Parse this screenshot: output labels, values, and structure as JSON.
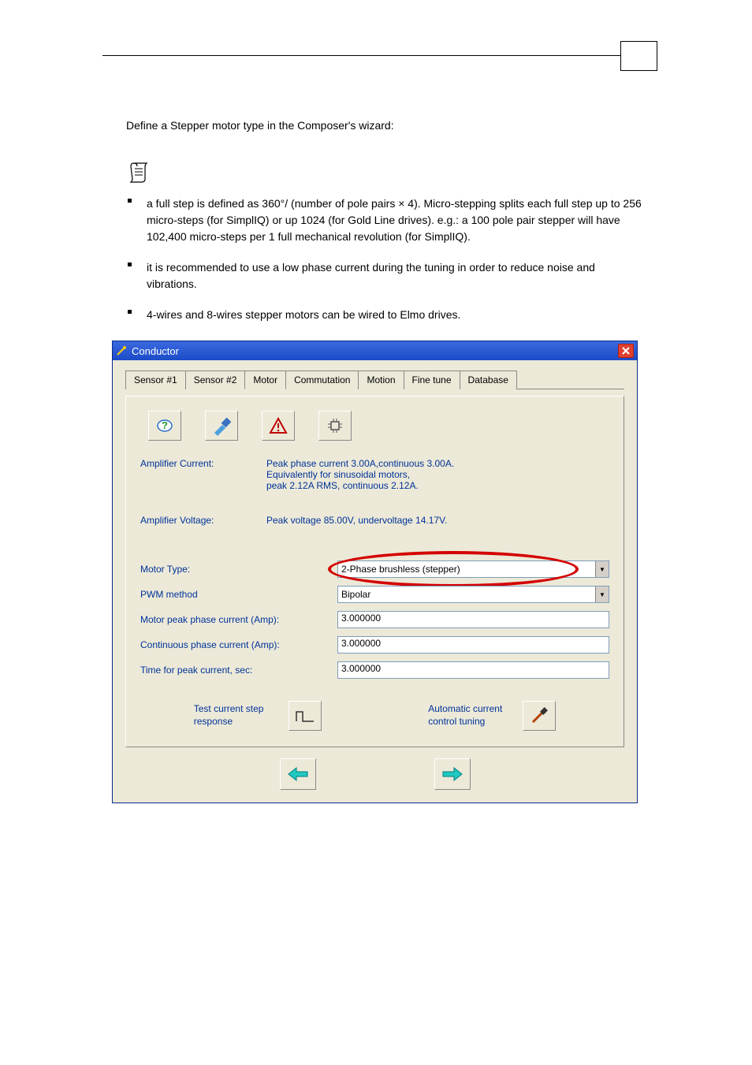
{
  "doc": {
    "intro_line": "Define a Stepper motor type in the Composer's wizard:",
    "notes": [
      "a full step is defined as 360°/ (number of pole pairs × 4). Micro-stepping splits each full step up to 256 micro-steps (for SimplIQ)  or up 1024 (for Gold Line drives). e.g.: a 100 pole pair stepper will have 102,400 micro-steps per 1 full mechanical revolution (for SimplIQ).",
      "it is recommended to use a low phase current during the tuning in order to reduce noise and vibrations.",
      "4-wires and 8-wires stepper motors can be wired to Elmo drives."
    ]
  },
  "dialog": {
    "title": "Conductor",
    "tabs": [
      "Sensor #1",
      "Sensor #2",
      "Motor",
      "Commutation",
      "Motion",
      "Fine tune",
      "Database"
    ],
    "selected_tab_index": 2,
    "amp_current_label": "Amplifier Current:",
    "amp_current_value": "Peak phase current 3.00A,continuous 3.00A.\nEquivalently for sinusoidal motors,\npeak 2.12A RMS, continuous 2.12A.",
    "amp_voltage_label": "Amplifier Voltage:",
    "amp_voltage_value": "Peak voltage 85.00V, undervoltage 14.17V.",
    "fields": {
      "motor_type_label": "Motor Type:",
      "motor_type_value": "2-Phase brushless (stepper)",
      "pwm_label": "PWM method",
      "pwm_value": "Bipolar",
      "peak_current_label": "Motor peak phase current (Amp):",
      "peak_current_value": "3.000000",
      "cont_current_label": "Continuous phase current (Amp):",
      "cont_current_value": "3.000000",
      "time_peak_label": "Time for peak current, sec:",
      "time_peak_value": "3.000000"
    },
    "actions": {
      "test_step_label": "Test current step response",
      "auto_tune_label": "Automatic current control tuning"
    },
    "icons": {
      "help": "help-icon",
      "brush": "brush-icon",
      "warning": "warning-icon",
      "chip": "chip-icon",
      "step": "step-response-icon",
      "screwdriver": "screwdriver-icon",
      "back": "back-arrow-icon",
      "next": "next-arrow-icon",
      "close": "close-icon",
      "wand": "wand-icon"
    }
  }
}
